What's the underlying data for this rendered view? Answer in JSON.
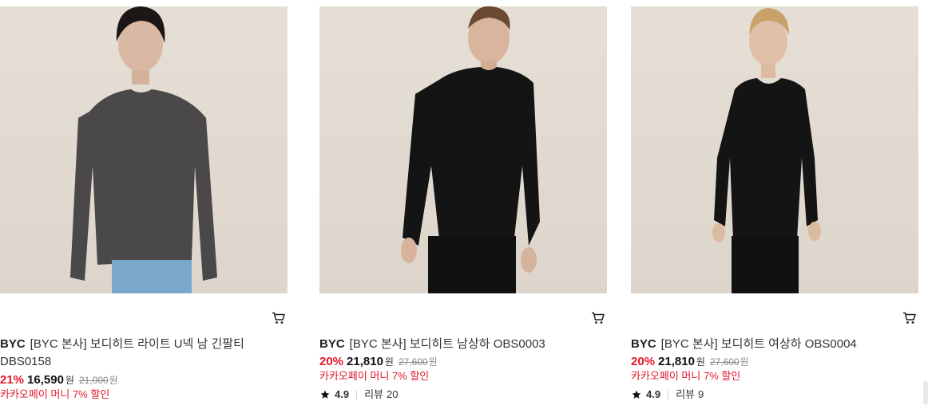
{
  "products": [
    {
      "brand": "BYC",
      "name": "[BYC 본사] 보디히트 남상하 OBS0003",
      "discount": "20%",
      "price": "21,810",
      "currency": "원",
      "original_price": "27,600",
      "promo": "카카오페이 머니 7% 할인",
      "rating": "4.9",
      "review_label": "리뷰",
      "review_count": "20",
      "shirt_color": "#141414",
      "image_desc_icon": "product-photo"
    },
    {
      "brand": "BYC",
      "name": "[BYC 본사] 보디히트 여상하 OBS0004",
      "discount": "20%",
      "price": "21,810",
      "currency": "원",
      "original_price": "27,600",
      "promo": "카카오페이 머니 7% 할인",
      "rating": "4.9",
      "review_label": "리뷰",
      "review_count": "9",
      "shirt_color": "#141414",
      "image_desc_icon": "product-photo"
    },
    {
      "brand": "BYC",
      "name_line1": "[BYC 본사] 보디히트 라이트 U넥 남 긴팔티",
      "name_line2": "DBS0158",
      "discount": "21%",
      "price": "16,590",
      "currency": "원",
      "original_price": "21,000",
      "promo": "카카오페이 머니 7% 할인",
      "shirt_color": "#4a4848",
      "image_desc_icon": "product-photo"
    }
  ],
  "colors": {
    "discount": "#e4162b",
    "promo": "#e4162b",
    "background": "#ffffff",
    "photo_bg": "#e2dbd1"
  },
  "icons": {
    "cart": "cart-icon",
    "star": "star-icon"
  }
}
